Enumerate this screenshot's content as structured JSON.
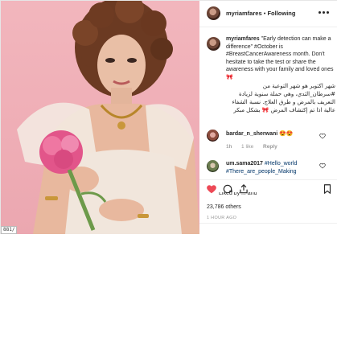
{
  "post": {
    "username": "myriamfares",
    "follow_separator": "•",
    "follow_label": "Following",
    "image_url_fragment": "881/"
  },
  "caption": {
    "username": "myriamfares",
    "text_en": "\"Early detection can make a difference\" #October is #BreastCancerAwareness month. Don't hesitate to take the test or share the awareness with your family and loved ones 🎀",
    "text_ar": "شهر اكتوبر هو شهر التوعية من #سرطان_الثدي، وهي حملة سنوية لزيادة التعريف بالمرض و طرق العلاج. نسبة الشفاء عالية اذا تم إكتشاف المرض 🎀 بشكل مبكر",
    "meta_time": "1h"
  },
  "comments": [
    {
      "username": "bardar_n_sherwani",
      "text": "😍😍",
      "time": "1h",
      "likes": "1 like",
      "reply": "Reply"
    },
    {
      "username": "um.sama2017",
      "text": "#Hello_world #There_are_people_Making"
    }
  ],
  "actions": {
    "like_icon": "heart-filled-icon",
    "comment_icon": "comment-icon",
    "share_icon": "share-icon",
    "save_icon": "bookmark-icon"
  },
  "likes": {
    "partial_text": "Liked by ... and",
    "count_text": "23,786 others"
  },
  "timestamp": "1 HOUR AGO",
  "colors": {
    "like_red": "#ed4956",
    "link_blue": "#003569",
    "muted": "#999999",
    "photo_bg": "#efaeb6"
  }
}
